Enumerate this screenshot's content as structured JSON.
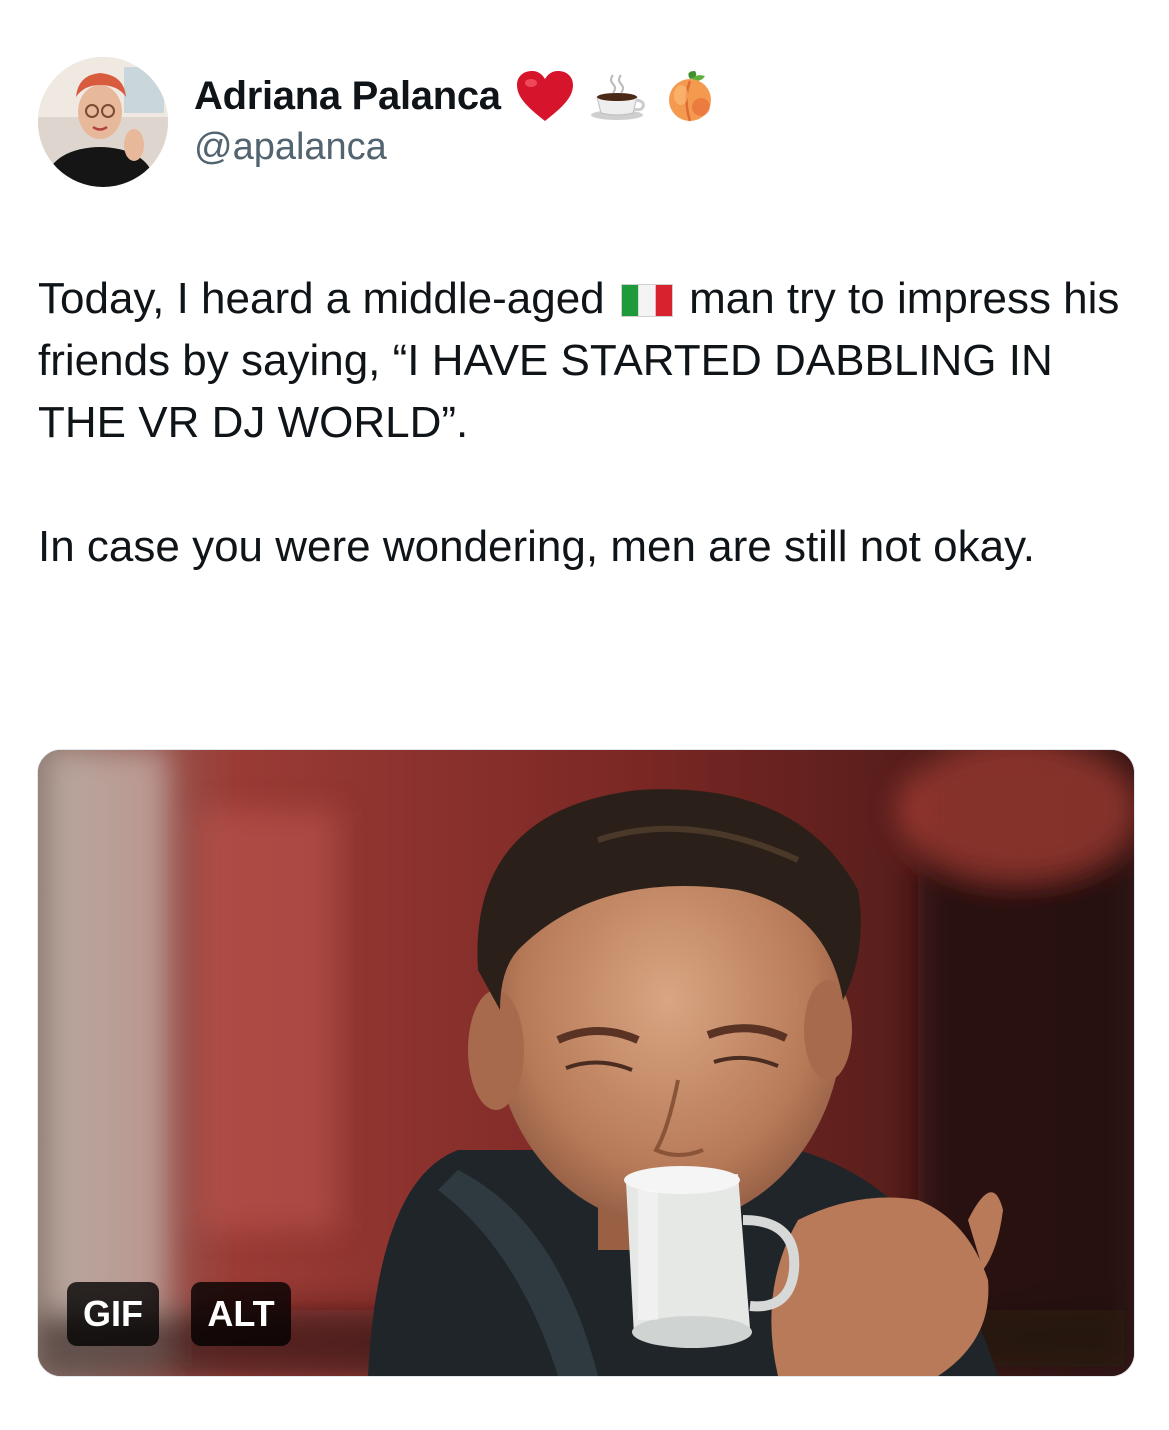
{
  "author": {
    "display_name": "Adriana Palanca",
    "handle": "@apalanca",
    "name_emojis": [
      "heart-icon",
      "coffee-cup-icon",
      "peach-icon"
    ],
    "avatar_icon": "avatar"
  },
  "tweet": {
    "line1_before_flag": "Today, I heard a middle-aged",
    "flag_icon": "italy-flag-icon",
    "line1_after_flag": "man try to impress his friends by saying, “I HAVE STARTED DABBLING IN THE VR DJ WORLD”.",
    "paragraph2": "In case you were wondering, men are still not okay."
  },
  "media": {
    "gif_badge": "GIF",
    "alt_badge": "ALT"
  },
  "colors": {
    "text": "#0f1419",
    "secondary_text": "#536471",
    "heart": "#d6152c",
    "badge_bg": "#1a1a1a"
  }
}
